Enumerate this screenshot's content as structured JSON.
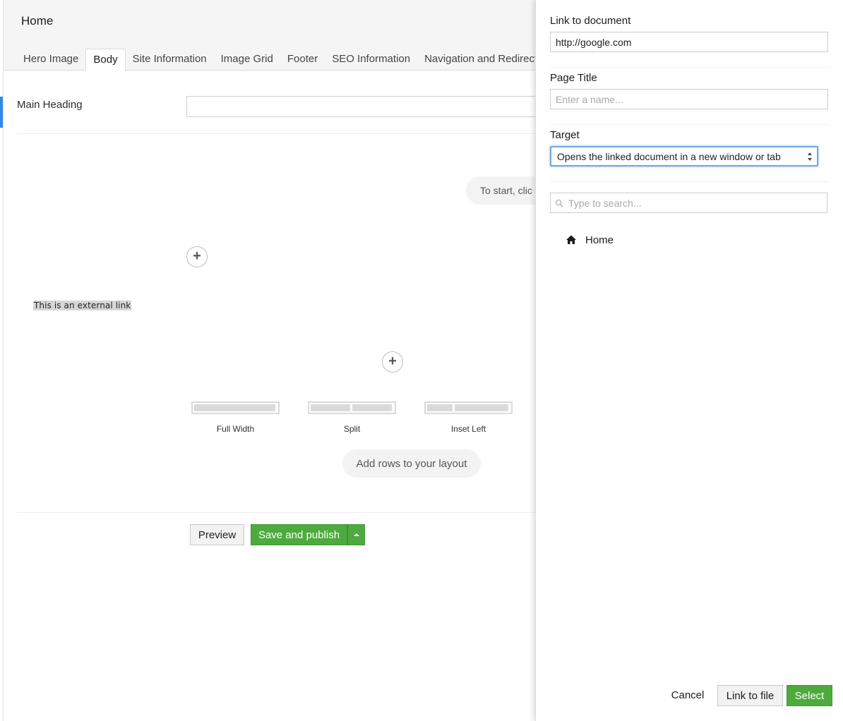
{
  "header": {
    "node_name": "Home",
    "tabs": [
      {
        "label": "Hero Image"
      },
      {
        "label": "Body",
        "active": true
      },
      {
        "label": "Site Information"
      },
      {
        "label": "Image Grid"
      },
      {
        "label": "Footer"
      },
      {
        "label": "SEO Information"
      },
      {
        "label": "Navigation and Redirects"
      }
    ]
  },
  "editor": {
    "main_heading_label": "Main Heading",
    "main_heading_value": "",
    "start_hint": "To start, clic",
    "external_link_text": "This is an external link",
    "layouts": [
      {
        "label": "Full Width"
      },
      {
        "label": "Split"
      },
      {
        "label": "Inset Left"
      }
    ],
    "add_rows_label": "Add rows to your layout",
    "preview_label": "Preview",
    "save_publish_label": "Save and publish"
  },
  "panel": {
    "link_label": "Link to document",
    "link_value": "http://google.com",
    "page_title_label": "Page Title",
    "page_title_placeholder": "Enter a name...",
    "target_label": "Target",
    "target_value": "Opens the linked document in a new window or tab",
    "search_placeholder": "Type to search...",
    "tree_root": "Home",
    "cancel_label": "Cancel",
    "link_file_label": "Link to file",
    "select_label": "Select"
  },
  "colors": {
    "accent_green": "#4daa3d",
    "focus_blue": "#6fa8e6",
    "left_accent": "#2e8aea"
  }
}
